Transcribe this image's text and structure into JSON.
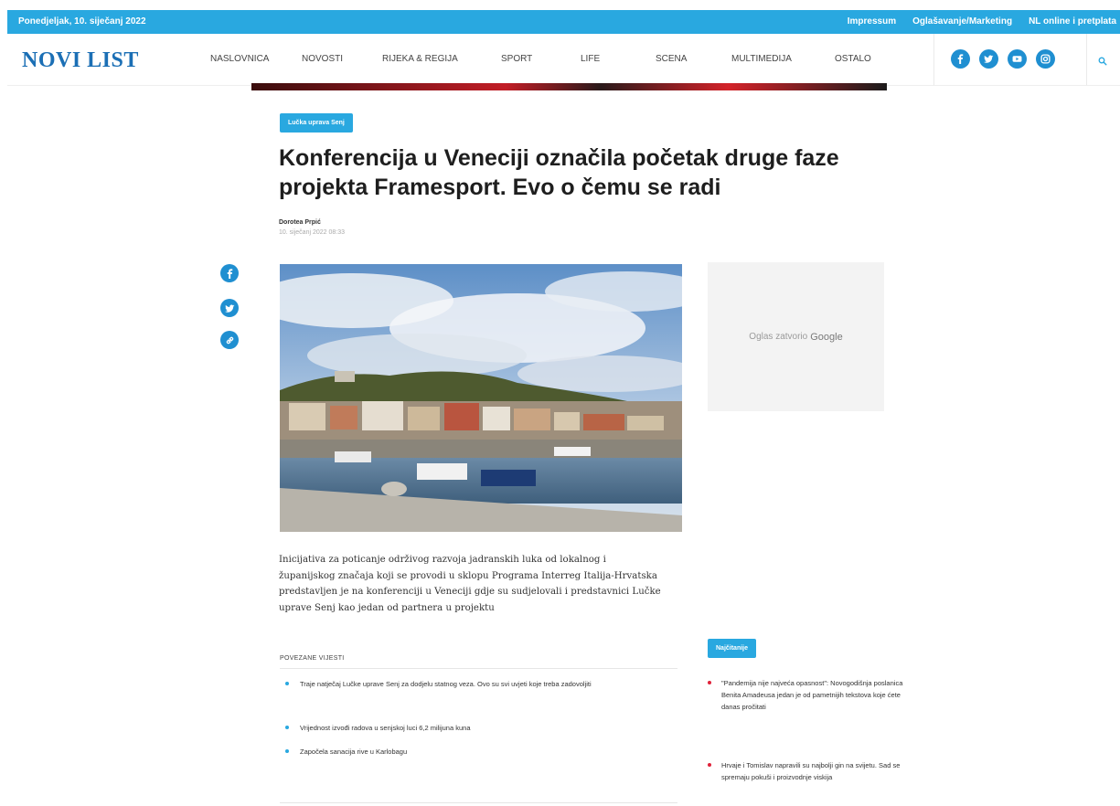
{
  "topbar": {
    "date": "Ponedjeljak, 10. siječanj 2022",
    "links": [
      "Impressum",
      "Oglašavanje/Marketing",
      "NL online i pretplata"
    ]
  },
  "header": {
    "logo": "NOVI LIST",
    "menu": [
      "NASLOVNICA",
      "NOVOSTI",
      "RIJEKA & REGIJA",
      "SPORT",
      "LIFE",
      "SCENA",
      "MULTIMEDIJA",
      "OSTALO"
    ],
    "social_icons": [
      "facebook-icon",
      "twitter-icon",
      "youtube-icon",
      "instagram-icon"
    ],
    "search_icon": "search-icon"
  },
  "article": {
    "category": "Lučka uprava Senj",
    "title": "Konferencija u Veneciji označila početak druge faze projekta Framesport. Evo o čemu se radi",
    "author": "Dorotea Prpić",
    "date": "10. siječanj 2022 08:33",
    "lead": "Inicijativa za poticanje održivog razvoja jadranskih luka od lokalnog i županijskog značaja koji se provodi u sklopu Programa Interreg Italija-Hrvatska predstavljen je na konferenciji u Veneciji gdje su sudjelovali i predstavnici Lučke uprave Senj kao jedan od partnera u projektu",
    "share_icons": [
      "facebook-icon",
      "twitter-icon",
      "link-icon"
    ]
  },
  "ad": {
    "text": "Oglas zatvorio",
    "brand": "Google"
  },
  "related": {
    "title": "POVEZANE VIJESTI",
    "items": [
      "Traje natječaj Lučke uprave Senj za dodjelu statnog veza. Ovo su svi uvjeti koje treba zadovoljiti",
      "Vrijednost izvođi radova u senjskoj luci 6,2 milijuna kuna",
      "Započela sanacija rive u Karlobagu"
    ]
  },
  "newest": {
    "title": "Najčitanije",
    "items": [
      "\"Pandemija nije najveća opasnost\": Novogodišnja poslanica Benita Amadeusa jedan je od pametnijih tekstova koje ćete danas pročitati",
      "Hrvaje i Tomislav napravili su najbolji gin na svijetu. Sad se spremaju pokuši i proizvodnje viskija"
    ]
  },
  "colors": {
    "accent": "#29a8e0",
    "logo": "#1b6fb5",
    "bullet_red": "#e0223a"
  }
}
